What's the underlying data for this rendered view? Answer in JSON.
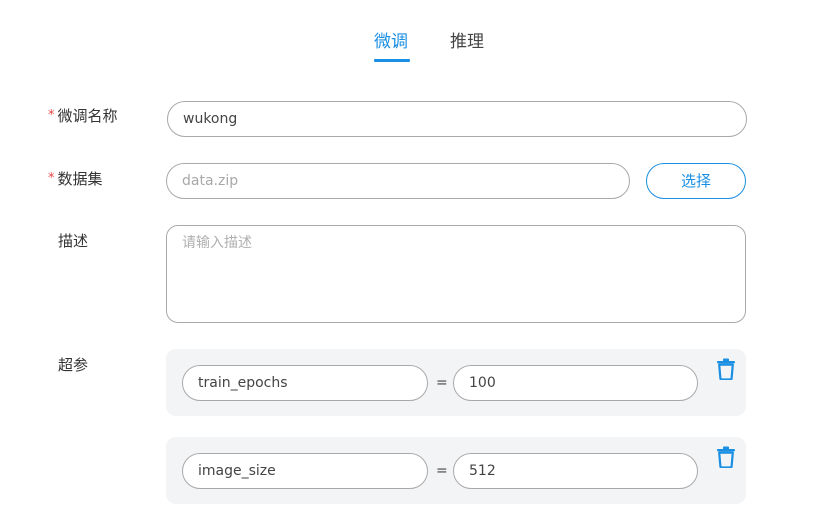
{
  "tabs": [
    {
      "label": "微调",
      "active": true
    },
    {
      "label": "推理",
      "active": false
    }
  ],
  "form": {
    "name": {
      "label": "微调名称",
      "required": true,
      "value": "wukong"
    },
    "dataset": {
      "label": "数据集",
      "required": true,
      "placeholder": "data.zip",
      "select_label": "选择"
    },
    "description": {
      "label": "描述",
      "placeholder": "请输入描述"
    },
    "hyperparams": {
      "label": "超参",
      "items": [
        {
          "key": "train_epochs",
          "separator": "=",
          "value": "100"
        },
        {
          "key": "image_size",
          "separator": "=",
          "value": "512"
        }
      ]
    }
  },
  "colors": {
    "accent": "#1a8fe3",
    "required_mark": "#e64646",
    "card_bg": "#f3f4f6"
  },
  "icons": {
    "delete": "trash-icon"
  }
}
